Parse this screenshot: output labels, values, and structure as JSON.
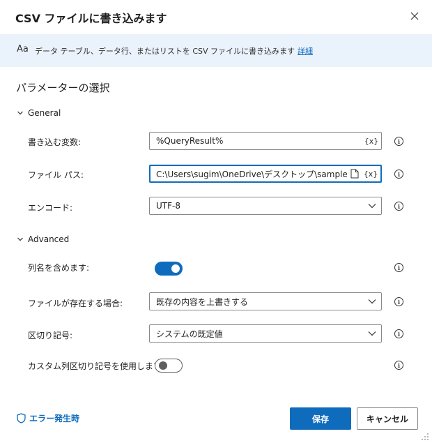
{
  "dialog": {
    "title": "CSV ファイルに書き込みます"
  },
  "banner": {
    "icon_text": "Aa",
    "text": "データ テーブル、データ行、またはリストを CSV ファイルに書き込みます",
    "link": "詳細"
  },
  "section": {
    "title": "パラメーターの選択"
  },
  "general": {
    "label": "General",
    "fields": [
      {
        "label": "書き込む変数:",
        "value": "%QueryResult%",
        "var_icon": "{x}"
      },
      {
        "label": "ファイル パス:",
        "value": "C:\\Users\\sugim\\OneDrive\\デスクトップ\\sample.csv",
        "var_icon": "{x}"
      },
      {
        "label": "エンコード:",
        "value": "UTF-8"
      }
    ]
  },
  "advanced": {
    "label": "Advanced",
    "fields": [
      {
        "label": "列名を含めます:",
        "toggle": true
      },
      {
        "label": "ファイルが存在する場合:",
        "value": "既存の内容を上書きする"
      },
      {
        "label": "区切り記号:",
        "value": "システムの既定値"
      },
      {
        "label": "カスタム列区切り記号を使用します:",
        "toggle": false
      }
    ]
  },
  "footer": {
    "error_link": "エラー発生時",
    "save": "保存",
    "cancel": "キャンセル"
  },
  "colors": {
    "accent": "#0f6cbd",
    "banner_bg": "#eaf2fb"
  }
}
